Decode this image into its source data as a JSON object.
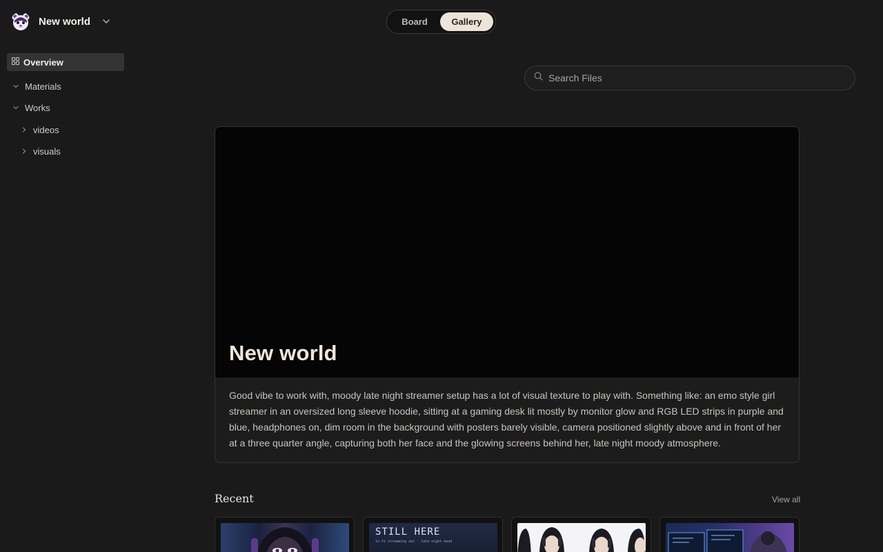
{
  "workspace": {
    "title": "New world",
    "avatar_icon": "bear-avatar",
    "chevron_icon": "chevron-down-icon"
  },
  "sidebar": {
    "overview": {
      "label": "Overview",
      "icon": "grid-icon"
    },
    "tree": [
      {
        "label": "Materials",
        "expanded": true,
        "level": 0
      },
      {
        "label": "Works",
        "expanded": true,
        "level": 0
      },
      {
        "label": "videos",
        "expanded": false,
        "level": 1
      },
      {
        "label": "visuals",
        "expanded": false,
        "level": 1
      }
    ]
  },
  "view_toggle": {
    "options": [
      "Board",
      "Gallery"
    ],
    "selected": "Gallery"
  },
  "search": {
    "placeholder": "Search Files",
    "icon": "search-icon"
  },
  "hero": {
    "title": "New world",
    "description": "Good vibe to work with, moody late night streamer setup has a lot of visual texture to play with. Something like: an emo style girl streamer in an oversized long sleeve hoodie, sitting at a gaming desk lit mostly by monitor glow and RGB LED strips in purple and blue, headphones on, dim room in the background with posters barely visible, camera positioned slightly above and in front of her at a three quarter angle, capturing both her face and the glowing screens behind her, late night moody atmosphere."
  },
  "recent": {
    "title": "Recent",
    "view_all": "View all",
    "items": [
      {
        "kind": "image"
      },
      {
        "kind": "image",
        "overlay_text": "STILL HERE",
        "overlay_subtext": "lo-fi streaming set · late night mood"
      },
      {
        "kind": "image"
      },
      {
        "kind": "image"
      }
    ]
  },
  "colors": {
    "background": "#1a1a1a",
    "accent_toggle": "#ece4d8",
    "sidebar_selected": "#333333",
    "text_primary": "#efe6da"
  }
}
